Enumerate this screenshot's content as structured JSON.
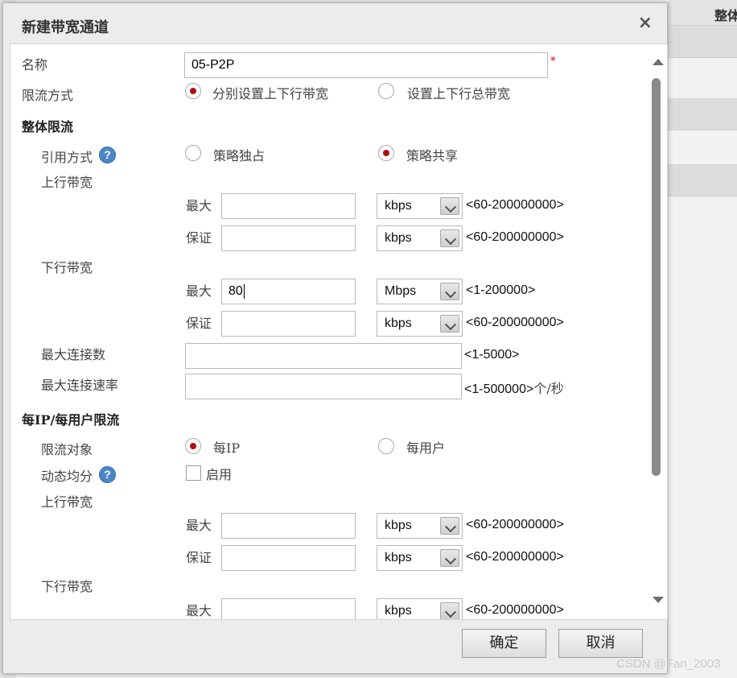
{
  "background": {
    "column_header": "整体"
  },
  "dialog": {
    "title": "新建带宽通道",
    "close_label": "×",
    "name_label": "名称",
    "name_value": "05-P2P",
    "required_mark": "*",
    "mode_label": "限流方式",
    "mode_options": [
      "分别设置上下行带宽",
      "设置上下行总带宽"
    ],
    "mode_selected": 0,
    "overall": {
      "title": "整体限流",
      "ref_label": "引用方式",
      "ref_options": [
        "策略独占",
        "策略共享"
      ],
      "ref_selected": 1,
      "up_label": "上行带宽",
      "down_label": "下行带宽",
      "max_label": "最大",
      "guar_label": "保证",
      "up_max": {
        "value": "",
        "unit": "kbps",
        "range": "<60-200000000>"
      },
      "up_guar": {
        "value": "",
        "unit": "kbps",
        "range": "<60-200000000>"
      },
      "down_max": {
        "value": "80",
        "unit": "Mbps",
        "range": "<1-200000>"
      },
      "down_guar": {
        "value": "",
        "unit": "kbps",
        "range": "<60-200000000>"
      },
      "max_conn_label": "最大连接数",
      "max_conn_range": "<1-5000>",
      "max_rate_label": "最大连接速率",
      "max_rate_range": "<1-500000>",
      "max_rate_unit": "个/秒"
    },
    "per": {
      "title": "每IP/每用户限流",
      "target_label": "限流对象",
      "target_options": [
        "每IP",
        "每用户"
      ],
      "target_selected": 0,
      "dynamic_label": "动态均分",
      "enable_label": "启用",
      "enable_checked": false,
      "up_label": "上行带宽",
      "down_label": "下行带宽",
      "max_label": "最大",
      "guar_label": "保证",
      "up_max": {
        "value": "",
        "unit": "kbps",
        "range": "<60-200000000>"
      },
      "up_guar": {
        "value": "",
        "unit": "kbps",
        "range": "<60-200000000>"
      },
      "down_max": {
        "value": "",
        "unit": "kbps",
        "range": "<60-200000000>"
      }
    },
    "ok_label": "确定",
    "cancel_label": "取消"
  },
  "watermark": "CSDN @Fan_2003",
  "colors": {
    "radio_selected": "#b01010",
    "help_icon": "#4b87c8",
    "required": "#d9001b"
  }
}
